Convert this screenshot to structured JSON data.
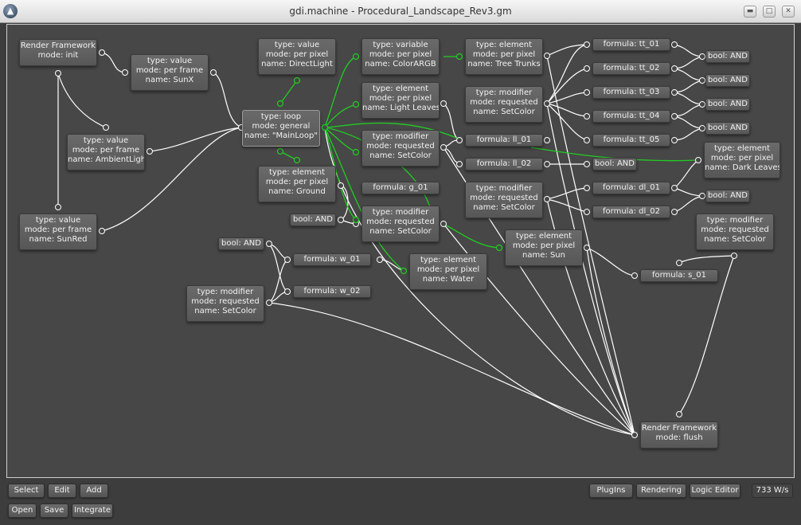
{
  "window": {
    "title": "gdi.machine - Procedural_Landscape_Rev3.gm",
    "logo_glyph": "▲",
    "minimize_glyph": "▬",
    "maximize_glyph": "□",
    "close_glyph": "✕"
  },
  "nodes": {
    "render_init": [
      "Render Framework",
      "mode: init"
    ],
    "sunx": [
      "type: value",
      "mode: per frame",
      "name: SunX"
    ],
    "directlight": [
      "type: value",
      "mode: per pixel",
      "name: DirectLight"
    ],
    "colorargb": [
      "type: variable",
      "mode: per pixel",
      "name: ColorARGB"
    ],
    "tree_trunks": [
      "type: element",
      "mode: per pixel",
      "name: Tree Trunks"
    ],
    "tt_01": [
      "formula: tt_01"
    ],
    "tt_02": [
      "formula: tt_02"
    ],
    "tt_03": [
      "formula: tt_03"
    ],
    "tt_04": [
      "formula: tt_04"
    ],
    "tt_05": [
      "formula: tt_05"
    ],
    "bool_and_1": [
      "bool: AND"
    ],
    "bool_and_2": [
      "bool: AND"
    ],
    "bool_and_3": [
      "bool: AND"
    ],
    "bool_and_4": [
      "bool: AND"
    ],
    "light_leaves": [
      "type: element",
      "mode: per pixel",
      "name: Light Leaves"
    ],
    "setcolor_tt": [
      "type: modifier",
      "mode: requested",
      "name: SetColor"
    ],
    "ambient": [
      "type: value",
      "mode: per frame",
      "name: AmbientLight"
    ],
    "mainloop": [
      "type: loop",
      "mode: general",
      "name: \"MainLoop\""
    ],
    "setcolor_ll": [
      "type: modifier",
      "mode: requested",
      "name: SetColor"
    ],
    "ll_01": [
      "formula: ll_01"
    ],
    "ll_02": [
      "formula: ll_02"
    ],
    "bool_and_ll": [
      "bool: AND"
    ],
    "dark_leaves": [
      "type: element",
      "mode: per pixel",
      "name: Dark Leaves"
    ],
    "ground": [
      "type: element",
      "mode: per pixel",
      "name: Ground"
    ],
    "g_01": [
      "formula: g_01"
    ],
    "setcolor_dl": [
      "type: modifier",
      "mode: requested",
      "name: SetColor"
    ],
    "dl_01": [
      "formula: dl_01"
    ],
    "dl_02": [
      "formula: dl_02"
    ],
    "bool_and_dl": [
      "bool: AND"
    ],
    "bool_and_g": [
      "bool: AND"
    ],
    "setcolor_g": [
      "type: modifier",
      "mode: requested",
      "name: SetColor"
    ],
    "sunred": [
      "type: value",
      "mode: per frame",
      "name: SunRed"
    ],
    "sun": [
      "type: element",
      "mode: per pixel",
      "name: Sun"
    ],
    "setcolor_sun": [
      "type: modifier",
      "mode: requested",
      "name: SetColor"
    ],
    "bool_and_w": [
      "bool: AND"
    ],
    "w_01": [
      "formula: w_01"
    ],
    "water": [
      "type: element",
      "mode: per pixel",
      "name: Water"
    ],
    "s_01": [
      "formula: s_01"
    ],
    "w_02": [
      "formula: w_02"
    ],
    "setcolor_w": [
      "type: modifier",
      "mode: requested",
      "name: SetColor"
    ],
    "render_flush": [
      "Render Framework",
      "mode: flush"
    ]
  },
  "toolbar": {
    "select": "Select",
    "edit": "Edit",
    "add": "Add",
    "open": "Open",
    "save": "Save",
    "integrate": "Integrate",
    "plugins": "PlugIns",
    "rendering": "Rendering",
    "logic_editor": "Logic Editor"
  },
  "status": {
    "rate": "733 W/s"
  },
  "colors": {
    "active_wire": "#22cc22",
    "wire": "#ffffff",
    "canvas": "#474747",
    "node": "#616161"
  }
}
